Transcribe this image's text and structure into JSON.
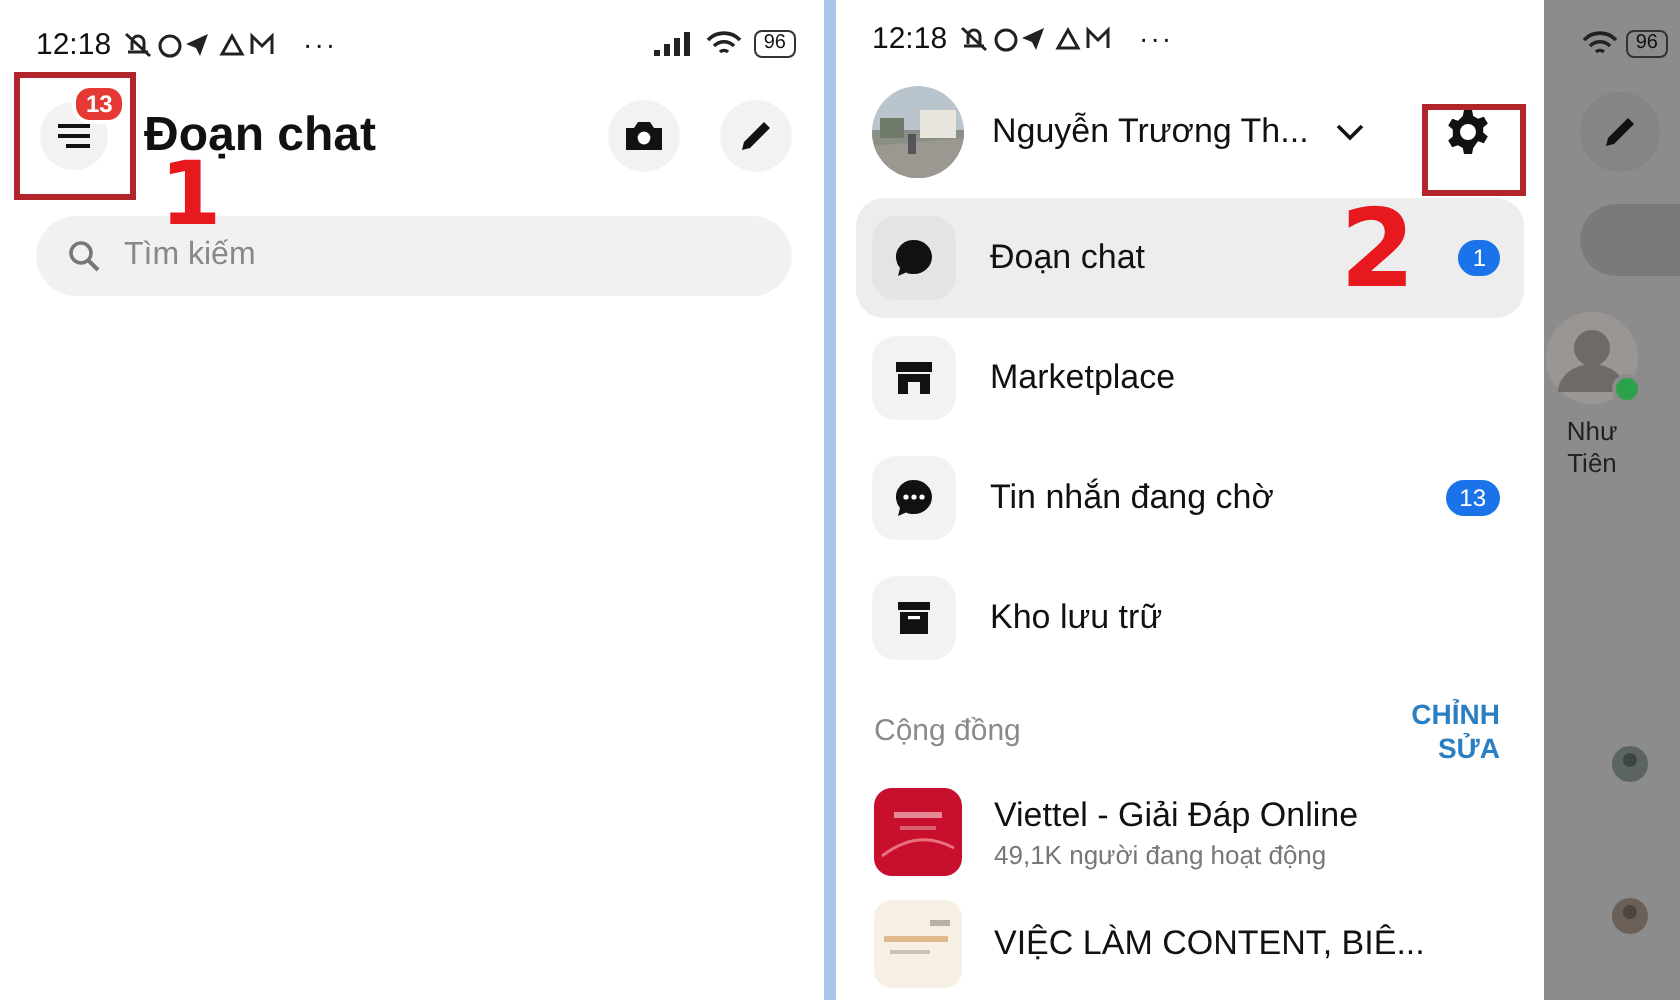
{
  "left_screen": {
    "status_bar": {
      "time": "12:18",
      "more": "···",
      "battery": "96"
    },
    "header": {
      "menu_badge": "13",
      "title": "Đoạn chat"
    },
    "search": {
      "placeholder": "Tìm kiếm"
    },
    "annotation": "1"
  },
  "right_screen": {
    "status_bar": {
      "time": "12:18",
      "more": "···",
      "battery": "96"
    },
    "profile": {
      "name": "Nguyễn Trương Th..."
    },
    "annotation": "2",
    "menu": [
      {
        "label": "Đoạn chat",
        "badge": "1",
        "selected": true
      },
      {
        "label": "Marketplace",
        "selected": false
      },
      {
        "label": "Tin nhắn đang chờ",
        "badge": "13",
        "selected": false
      },
      {
        "label": "Kho lưu trữ",
        "selected": false
      }
    ],
    "section": {
      "title": "Cộng đồng",
      "action": "CHỈNH SỬA"
    },
    "communities": [
      {
        "name": "Viettel - Giải Đáp Online",
        "subtitle": "49,1K người đang hoạt động"
      },
      {
        "name": "VIỆC LÀM CONTENT, BIÊ..."
      }
    ],
    "background": {
      "contact_name": "Như Tiên"
    }
  }
}
